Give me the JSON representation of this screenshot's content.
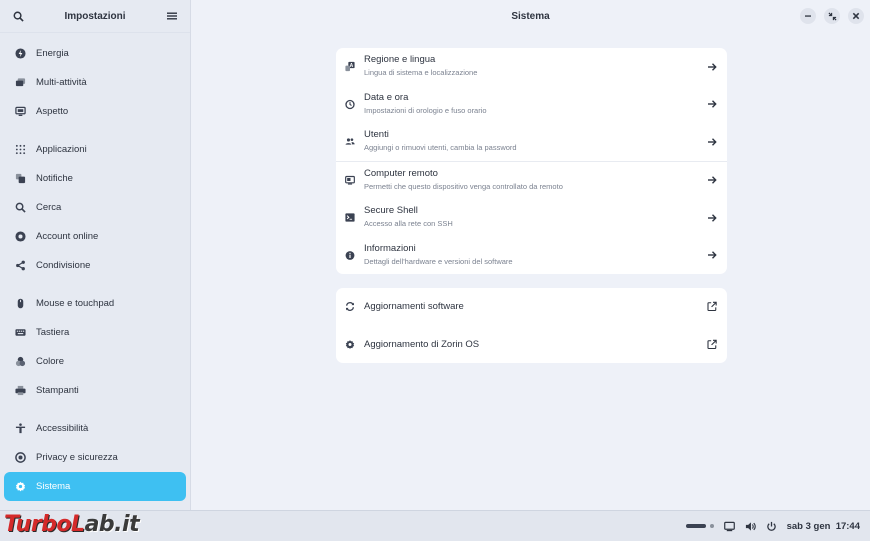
{
  "sidebar": {
    "title": "Impostazioni",
    "items": [
      {
        "label": "Energia",
        "icon": "power-icon"
      },
      {
        "label": "Multi-attività",
        "icon": "multitasking-icon"
      },
      {
        "label": "Aspetto",
        "icon": "display-icon"
      },
      {
        "label": "Applicazioni",
        "icon": "apps-grid-icon"
      },
      {
        "label": "Notifiche",
        "icon": "bell-icon"
      },
      {
        "label": "Cerca",
        "icon": "search-icon"
      },
      {
        "label": "Account online",
        "icon": "cloud-icon"
      },
      {
        "label": "Condivisione",
        "icon": "share-icon"
      },
      {
        "label": "Mouse e touchpad",
        "icon": "mouse-icon"
      },
      {
        "label": "Tastiera",
        "icon": "keyboard-icon"
      },
      {
        "label": "Colore",
        "icon": "palette-icon"
      },
      {
        "label": "Stampanti",
        "icon": "printer-icon"
      },
      {
        "label": "Accessibilità",
        "icon": "accessibility-icon"
      },
      {
        "label": "Privacy e sicurezza",
        "icon": "shield-icon"
      },
      {
        "label": "Sistema",
        "icon": "gear-icon"
      }
    ]
  },
  "main": {
    "title": "Sistema",
    "group1": [
      {
        "title": "Regione e lingua",
        "subtitle": "Lingua di sistema e localizzazione",
        "icon": "language-icon"
      },
      {
        "title": "Data e ora",
        "subtitle": "Impostazioni di orologio e fuso orario",
        "icon": "clock-icon"
      },
      {
        "title": "Utenti",
        "subtitle": "Aggiungi o rimuovi utenti, cambia la password",
        "icon": "users-icon"
      },
      {
        "title": "Computer remoto",
        "subtitle": "Permetti che questo dispositivo venga controllato da remoto",
        "icon": "remote-desktop-icon"
      },
      {
        "title": "Secure Shell",
        "subtitle": "Accesso alla rete con SSH",
        "icon": "terminal-icon"
      },
      {
        "title": "Informazioni",
        "subtitle": "Dettagli dell'hardware e versioni del software",
        "icon": "info-icon"
      }
    ],
    "group2": [
      {
        "title": "Aggiornamenti software",
        "icon": "refresh-icon"
      },
      {
        "title": "Aggiornamento di Zorin OS",
        "icon": "gear-icon"
      }
    ]
  },
  "taskbar": {
    "clock": "sab 3 gen  17:44",
    "watermark_a": "TurboL",
    "watermark_b": "ab.it"
  },
  "colors": {
    "accent": "#3ec0f2",
    "watermark": "#d42a2a"
  }
}
